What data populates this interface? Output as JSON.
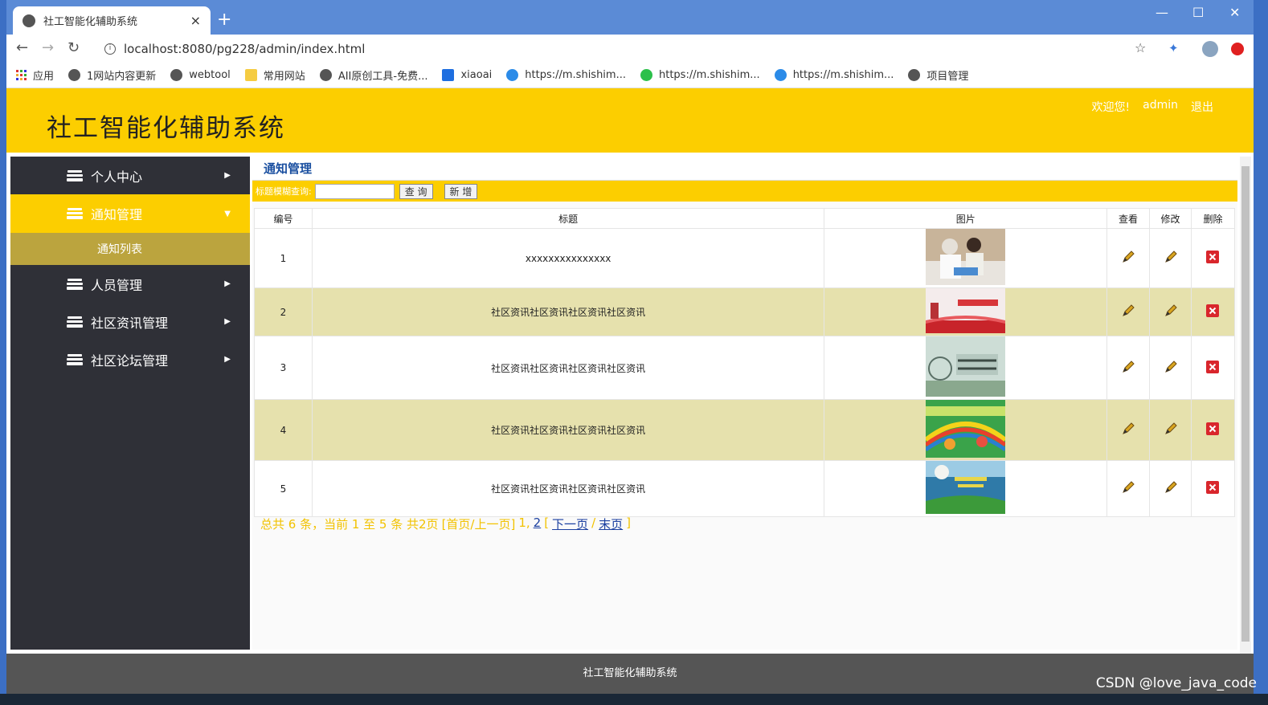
{
  "browser": {
    "tab_title": "社工智能化辅助系统",
    "tab_close": "×",
    "new_tab": "+",
    "url": "localhost:8080/pg228/admin/index.html",
    "window_controls": [
      "—",
      "☐",
      "✕"
    ],
    "bookmarks": [
      "应用",
      "1网站内容更新",
      "webtool",
      "常用网站",
      "AII原创工具-免费...",
      "xiaoai",
      "https://m.shishim...",
      "https://m.shishim...",
      "https://m.shishim...",
      "项目管理"
    ]
  },
  "header": {
    "title": "社工智能化辅助系统",
    "welcome": "欢迎您!",
    "user": "admin",
    "logout": "退出"
  },
  "sidebar": {
    "items": [
      {
        "label": "个人中心",
        "arrow": "▶"
      },
      {
        "label": "通知管理",
        "arrow": "▼"
      },
      {
        "label": "人员管理",
        "arrow": "▶"
      },
      {
        "label": "社区资讯管理",
        "arrow": "▶"
      },
      {
        "label": "社区论坛管理",
        "arrow": "▶"
      }
    ],
    "submenu": "通知列表"
  },
  "content": {
    "heading": "通知管理",
    "search_label": "标题模糊查询:",
    "search_value": "",
    "query_button": "查 询",
    "add_button": "新 增"
  },
  "table": {
    "headers": [
      "编号",
      "标题",
      "图片",
      "查看",
      "修改",
      "删除"
    ],
    "rows": [
      {
        "id": "1",
        "title": "xxxxxxxxxxxxxxx"
      },
      {
        "id": "2",
        "title": "社区资讯社区资讯社区资讯社区资讯"
      },
      {
        "id": "3",
        "title": "社区资讯社区资讯社区资讯社区资讯"
      },
      {
        "id": "4",
        "title": "社区资讯社区资讯社区资讯社区资讯"
      },
      {
        "id": "5",
        "title": "社区资讯社区资讯社区资讯社区资讯"
      }
    ]
  },
  "pager": {
    "summary": "总共 6 条，当前 1 至 5 条 共2页",
    "first_prev": "[首页/上一页]",
    "page_current": "1,",
    "page_2": "2",
    "bracket_open": "[",
    "next": "下一页",
    "sep": "/",
    "last": "末页",
    "bracket_close": "]"
  },
  "footer": {
    "text": "社工智能化辅助系统"
  },
  "watermark": "CSDN @love_java_code",
  "colors": {
    "header_yellow": "#fcce00",
    "sidebar_dark": "#2f3037",
    "submenu_olive": "#bba43e",
    "row_even": "#e6e1ad",
    "delete_red": "#d9262c"
  }
}
